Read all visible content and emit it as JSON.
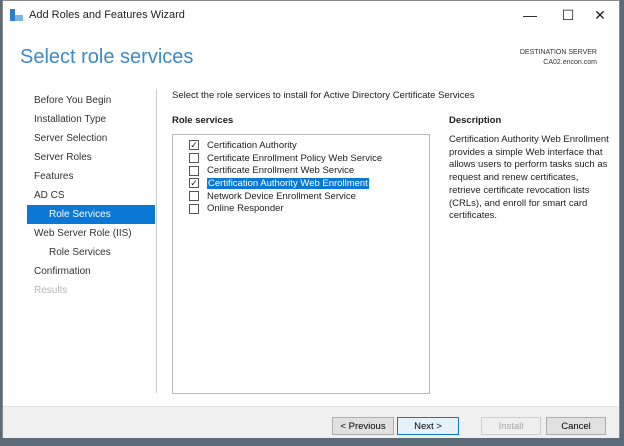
{
  "window": {
    "title": "Add Roles and Features Wizard",
    "controls": {
      "minimize": "—",
      "maximize": "☐",
      "close": "✕"
    }
  },
  "header": {
    "title": "Select role services",
    "destination_label": "DESTINATION SERVER",
    "destination_server": "CA02.encon.com"
  },
  "nav": [
    {
      "label": "Before You Begin",
      "state": "normal"
    },
    {
      "label": "Installation Type",
      "state": "normal"
    },
    {
      "label": "Server Selection",
      "state": "normal"
    },
    {
      "label": "Server Roles",
      "state": "normal"
    },
    {
      "label": "Features",
      "state": "normal"
    },
    {
      "label": "AD CS",
      "state": "normal"
    },
    {
      "label": "Role Services",
      "state": "selected"
    },
    {
      "label": "Web Server Role (IIS)",
      "state": "normal"
    },
    {
      "label": "Role Services",
      "state": "normal"
    },
    {
      "label": "Confirmation",
      "state": "normal"
    },
    {
      "label": "Results",
      "state": "disabled"
    }
  ],
  "main": {
    "intro": "Select the role services to install for Active Directory Certificate Services",
    "role_services_heading": "Role services",
    "role_services": [
      {
        "label": "Certification Authority",
        "checked": true
      },
      {
        "label": "Certificate Enrollment Policy Web Service",
        "checked": false
      },
      {
        "label": "Certificate Enrollment Web Service",
        "checked": false
      },
      {
        "label": "Certification Authority Web Enrollment",
        "checked": true,
        "highlighted": true
      },
      {
        "label": "Network Device Enrollment Service",
        "checked": false
      },
      {
        "label": "Online Responder",
        "checked": false
      }
    ],
    "description_heading": "Description",
    "description": "Certification Authority Web Enrollment provides a simple Web interface that allows users to perform tasks such as request and renew certificates, retrieve certificate revocation lists (CRLs), and enroll for smart card certificates."
  },
  "buttons": {
    "previous": "< Previous",
    "next": "Next >",
    "install": "Install",
    "cancel": "Cancel"
  },
  "colors": {
    "accent": "#0a78d4",
    "title_blue": "#3d8ac4"
  }
}
